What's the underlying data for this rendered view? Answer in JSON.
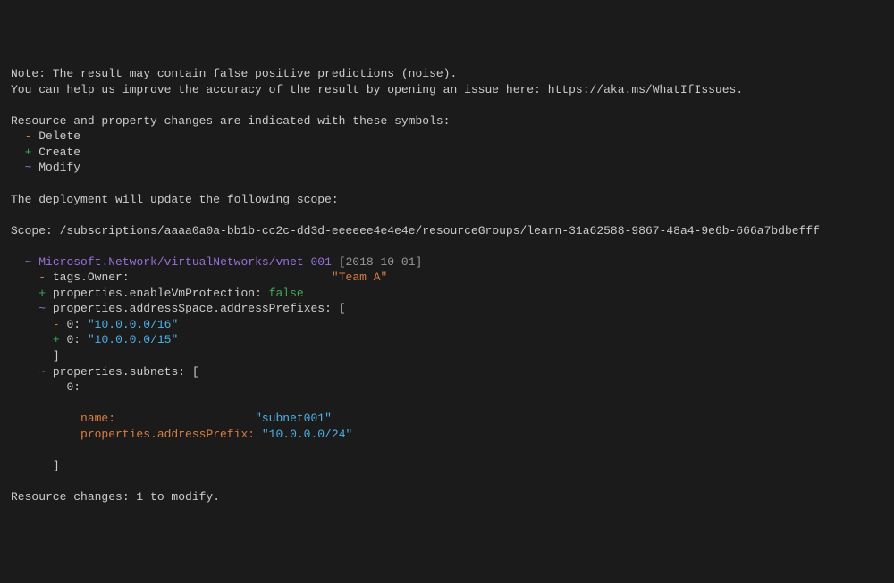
{
  "note": {
    "line1": "Note: The result may contain false positive predictions (noise).",
    "line2": "You can help us improve the accuracy of the result by opening an issue here: https://aka.ms/WhatIfIssues."
  },
  "symbols_intro": "Resource and property changes are indicated with these symbols:",
  "symbols": {
    "delete": {
      "sym": "-",
      "label": "Delete"
    },
    "create": {
      "sym": "+",
      "label": "Create"
    },
    "modify": {
      "sym": "~",
      "label": "Modify"
    }
  },
  "update_scope_intro": "The deployment will update the following scope:",
  "scope": {
    "prefix": "Scope: /subscriptions/",
    "sub_id": "aaaa0a0a-bb1b-cc2c-dd3d-eeeeee4e4e4e",
    "suffix": "/resourceGroups/learn-31a62588-9867-48a4-9e6b-666a7bdbefff"
  },
  "resource": {
    "sym": "~",
    "path": "Microsoft.Network/virtualNetworks/vnet-001",
    "api": "[2018-10-01]"
  },
  "changes": {
    "tags_owner": {
      "sym": "-",
      "name": "tags.Owner:",
      "value": "\"Team A\""
    },
    "enable_vm": {
      "sym": "+",
      "name": "properties.enableVmProtection:",
      "value": "false"
    },
    "addr_prefixes": {
      "sym": "~",
      "name": "properties.addressSpace.addressPrefixes:",
      "bracket": "["
    },
    "prefix0_del": {
      "sym": "-",
      "idx": "0:",
      "value": "\"10.0.0.0/16\""
    },
    "prefix0_add": {
      "sym": "+",
      "idx": "0:",
      "value": "\"10.0.0.0/15\""
    },
    "close_bracket1": "]",
    "subnets": {
      "sym": "~",
      "name": "properties.subnets:",
      "bracket": "["
    },
    "subnet0": {
      "sym": "-",
      "idx": "0:"
    },
    "subnet_name": {
      "label": "name:",
      "value": "\"subnet001\""
    },
    "subnet_prefix": {
      "label": "properties.addressPrefix:",
      "value": "\"10.0.0.0/24\""
    },
    "close_bracket2": "]"
  },
  "summary": "Resource changes: 1 to modify."
}
